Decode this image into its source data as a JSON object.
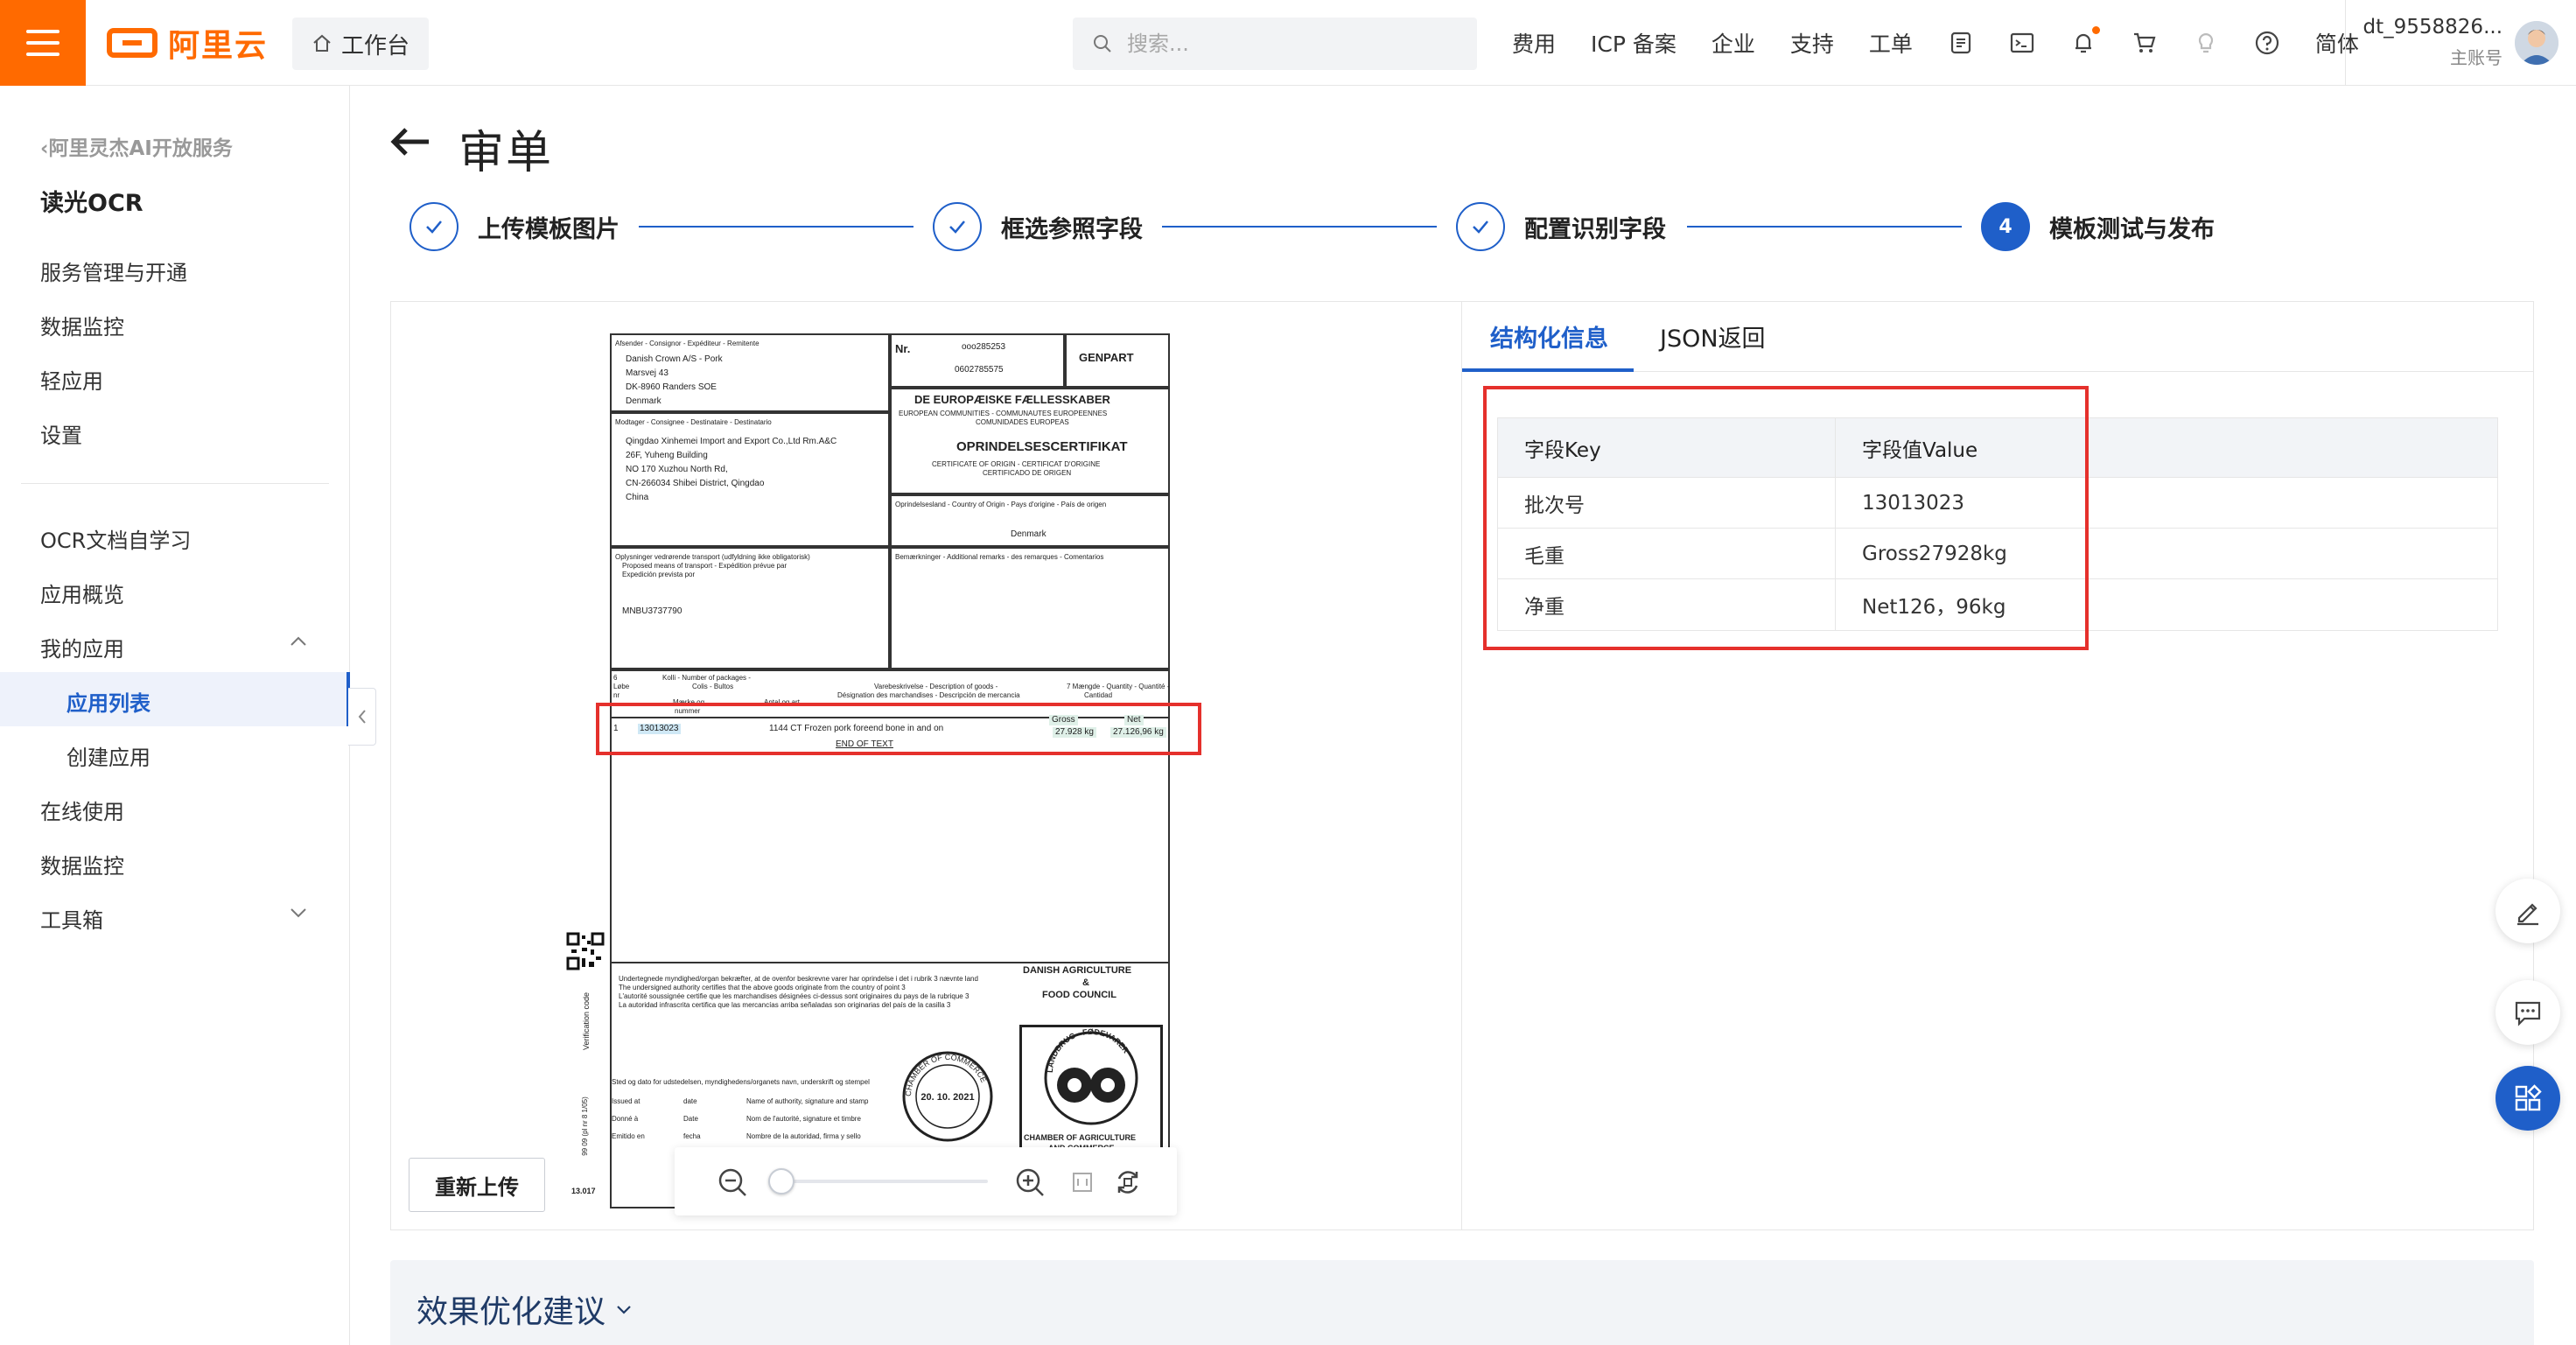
{
  "header": {
    "logo_text": "阿里云",
    "workbench_label": "工作台",
    "search_placeholder": "搜索...",
    "nav": [
      "费用",
      "ICP 备案",
      "企业",
      "支持",
      "工单"
    ],
    "lang_label": "简体",
    "account_name": "dt_9558826...",
    "account_role": "主账号",
    "icons": [
      "menu-icon",
      "home-icon",
      "search-icon",
      "app-icon",
      "terminal-icon",
      "bell-icon",
      "cart-icon",
      "bulb-icon",
      "help-icon"
    ],
    "accent_color": "#ff6a00"
  },
  "sidebar": {
    "back_label": "阿里灵杰AI开放服务",
    "product_title": "读光OCR",
    "group1": [
      "服务管理与开通",
      "数据监控",
      "轻应用",
      "设置"
    ],
    "group2": {
      "title": "OCR文档自学习",
      "overview": "应用概览",
      "my_apps": "我的应用",
      "app_list": "应用列表",
      "create_app": "创建应用",
      "online_use": "在线使用",
      "data_monitor": "数据监控",
      "toolbox": "工具箱"
    }
  },
  "page": {
    "title": "审单",
    "steps": [
      {
        "label": "上传模板图片",
        "state": "done"
      },
      {
        "label": "框选参照字段",
        "state": "done"
      },
      {
        "label": "配置识别字段",
        "state": "done"
      },
      {
        "label": "模板测试与发布",
        "state": "active",
        "number": "4"
      }
    ],
    "reupload_label": "重新上传",
    "zoom_level_fraction": 0.05,
    "tabs": [
      "结构化信息",
      "JSON返回"
    ],
    "table": {
      "headers": [
        "字段Key",
        "字段值Value"
      ],
      "rows": [
        [
          "批次号",
          "13013023"
        ],
        [
          "毛重",
          "Gross27928kg"
        ],
        [
          "净重",
          "Net126，96kg"
        ]
      ]
    },
    "optimize_title": "效果优化建议",
    "primary_color": "#1f5fc9",
    "highlight_color": "#e5302c"
  },
  "document": {
    "nr_label": "Nr.",
    "nr_value": "ooo285253",
    "nr_sub": "0602785575",
    "genpart": "GENPART",
    "box1_label": "Afsender - Consignor - Expéditeur - Remitente",
    "sender": [
      "Danish Crown A/S - Pork",
      "Marsvej 43",
      "DK-8960 Randers SOE",
      "Denmark"
    ],
    "box2_label": "Modtager - Consignee - Destinataire - Destinatario",
    "consignee": [
      "Qingdao Xinhemei Import and Export Co.,Ltd  Rm.A&C",
      "26F, Yuheng Building",
      "NO 170 Xuzhou North Rd,",
      "CN-266034 Shibei District, Qingdao",
      "China"
    ],
    "eu_title": "DE EUROPÆISKE FÆLLESSKABER",
    "eu_sub": [
      "EUROPEAN COMMUNITIES - COMMUNAUTES EUROPEENNES",
      "COMUNIDADES EUROPEAS"
    ],
    "cert_title": "OPRINDELSESCERTIFIKAT",
    "cert_sub": [
      "CERTIFICATE OF ORIGIN - CERTIFICAT D'ORIGINE",
      "CERTIFICADO DE ORIGEN"
    ],
    "box3_label": "Oprindelsesland - Country of Origin - Pays d'origine - País de origen",
    "country": "Denmark",
    "box4_label": [
      "Oplysninger vedrørende transport (udfyldning ikke obligatorisk)",
      "Proposed means of transport - Expédition prévue par",
      "Expedición prevista por"
    ],
    "box5_label": "Bemærkninger - Additional remarks - des remarques - Comentarios",
    "container": "MNBU3737790",
    "col_lobe": [
      "6",
      "Løbe",
      "nr"
    ],
    "col_kolli": [
      "Kolli - Number of packages -",
      "Colis - Bultos"
    ],
    "col_marks": [
      "Mærke og",
      "nummer"
    ],
    "col_antal": "Antal og art",
    "col_desc": [
      "Varebeskrivelse - Description of goods -",
      "Désignation des marchandises - Descripción de mercancia"
    ],
    "col_qty": [
      "7   Mængde - Quantity - Quantité -",
      "Cantidad"
    ],
    "line_no": "1",
    "line_batch": "13013023",
    "line_desc": "1144 CT  Frozen pork foreend bone in and on",
    "gross_label": "Gross",
    "gross_value": "27.928 kg",
    "net_label": "Net",
    "net_value": "27.126,96 kg",
    "end_text": "END OF TEXT",
    "council": [
      "DANISH AGRICULTURE",
      "&",
      "FOOD COUNCIL"
    ],
    "box8_text": [
      "Undertegnede myndighed/organ bekræfter, at de ovenfor beskrevne varer har oprindelse i det i rubrik 3 nævnte land",
      "The undersigned authority certifies that the above goods originate from the country of point 3",
      "L'autorité soussignée certifie que les marchandises désignées ci-dessus sont originaires du pays de la rubrique 3",
      "La autoridad infrascrita certifica que las mercancías arriba señaladas son originarias del país de la casilla 3"
    ],
    "sign_line": "Sted og dato for udstedelsen, myndighedens/organets navn, underskrift og stempel",
    "issued": [
      "Issued at",
      "Donné à",
      "Emitido en"
    ],
    "date": [
      "date",
      "Date",
      "fecha"
    ],
    "authority": [
      "Name of authority, signature and stamp",
      "Nom de l'autorité, signature et timbre",
      "Nombre de la autoridad, firma y sello"
    ],
    "stamp_date": "20. 10. 2021",
    "stamp_ring": "CHAMBER OF COMMERCE",
    "chamber": [
      "CHAMBER OF AGRICULTURE",
      "AND COMMERCE"
    ],
    "landbrug_text": "LANDBRUG · FØDEVARER",
    "verification": "Verification code",
    "form_code": "13.017",
    "side_code": "99 09  (pl nr 8 1/05)"
  }
}
